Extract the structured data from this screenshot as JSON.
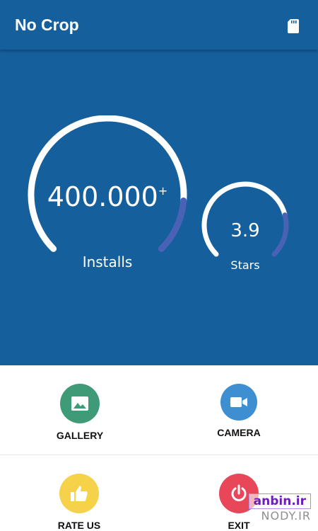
{
  "colors": {
    "primary": "#155f9c",
    "gauge_track": "#ffffff",
    "gauge_accent": "#4a62b5",
    "gallery": "#3f9a78",
    "camera": "#3d8fd1",
    "rate": "#f6d24a",
    "exit": "#e8475a"
  },
  "appbar": {
    "title": "No Crop",
    "sd_icon": "sd-card-icon"
  },
  "stats": {
    "installs": {
      "value": "400.000",
      "suffix": "+",
      "label": "Installs",
      "progress": 0.85
    },
    "stars": {
      "value": "3.9",
      "label": "Stars",
      "progress": 0.78
    }
  },
  "actions": {
    "gallery": {
      "label": "GALLERY",
      "icon": "image-icon"
    },
    "camera": {
      "label": "CAMERA",
      "icon": "video-camera-icon"
    },
    "rate": {
      "label": "RATE US",
      "icon": "thumbs-up-icon"
    },
    "exit": {
      "label": "EXIT",
      "icon": "power-icon"
    }
  },
  "watermark": {
    "line1": "anbin.ir",
    "line2": "NODY.IR"
  }
}
